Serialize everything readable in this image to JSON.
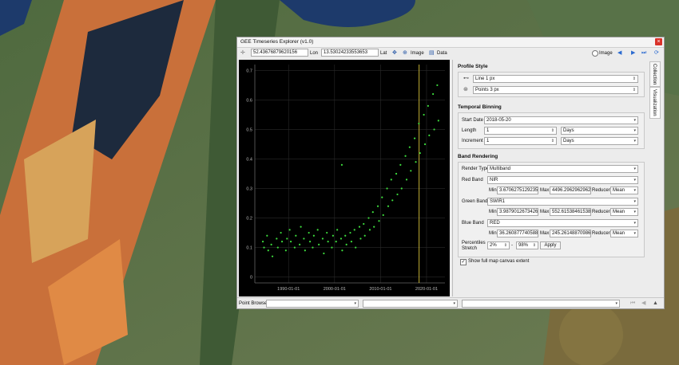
{
  "window": {
    "title": "GEE Timeseries Explorer (v1.0)",
    "close_label": "×"
  },
  "toolbar": {
    "coord1": "52.4367687962015​6",
    "coord1_label": "Lon",
    "coord2": "13.53024233553653",
    "coord2_label": "Lat",
    "image_label": "Image",
    "data_label": "Data",
    "mode_label": "Image"
  },
  "plot": {
    "y_ticks": [
      "0",
      "0.1",
      "0.2",
      "0.3",
      "0.4",
      "0.5",
      "0.6",
      "0.7"
    ],
    "x_ticks": [
      "1990-01-01",
      "2000-01-01",
      "2010-01-01",
      "2020-01-01"
    ]
  },
  "profile_style": {
    "title": "Profile Style",
    "line": "Line 1 px",
    "points": "Points 3 px"
  },
  "temporal_binning": {
    "title": "Temporal Binning",
    "start_date_label": "Start Date",
    "start_date": "2018-05-20",
    "length_label": "Length",
    "length": "1",
    "length_unit": "Days",
    "increment_label": "Increment",
    "increment": "1",
    "increment_unit": "Days"
  },
  "band_rendering": {
    "title": "Band Rendering",
    "render_type_label": "Render Type",
    "render_type": "Multiband",
    "red_label": "Red Band",
    "red_band": "NIR",
    "red_min": "3.670627512923595",
    "red_max": "4496.296296296296",
    "red_reducer": "Mean",
    "green_label": "Green Band",
    "green_band": "SWIR1",
    "green_min": "3.987901267342615",
    "green_max": "552.6153846153848",
    "green_reducer": "Mean",
    "blue_label": "Blue Band",
    "blue_band": "RED",
    "blue_min": "36.26087774058891",
    "blue_max": "245.2614887098605",
    "blue_reducer": "Mean",
    "min_label": "Min",
    "max_label": "Max",
    "reducer_label": "Reducer",
    "percentiles_label": "Percentiles Stretch",
    "pct_low": "2%",
    "pct_dash": "-",
    "pct_high": "98%",
    "apply_label": "Apply",
    "show_extent_label": "Show full map canvas extent"
  },
  "side_tabs": {
    "collection": "Collection",
    "visualization": "Visualization"
  },
  "bottom": {
    "point_browser_label": "Point Browser"
  },
  "colors": {
    "points": "#3ddc3d",
    "marker": "#d8c23a",
    "plot_bg": "#000000"
  },
  "chart_data": {
    "type": "scatter",
    "xlabel": "",
    "ylabel": "",
    "ylim": [
      -0.02,
      0.72
    ],
    "xlim": [
      "1982-09-01",
      "2024-01-01"
    ],
    "x_ticks": [
      "1990-01-01",
      "2000-01-01",
      "2010-01-01",
      "2020-01-01"
    ],
    "y_ticks": [
      0,
      0.1,
      0.2,
      0.3,
      0.4,
      0.5,
      0.6,
      0.7
    ],
    "grid": true,
    "marker_date": "2018-05-20",
    "series": [
      {
        "points": [
          [
            "1984-06-01",
            0.12
          ],
          [
            "1984-09-01",
            0.1
          ],
          [
            "1985-05-01",
            0.14
          ],
          [
            "1985-08-01",
            0.09
          ],
          [
            "1986-04-01",
            0.11
          ],
          [
            "1986-07-01",
            0.07
          ],
          [
            "1987-06-01",
            0.13
          ],
          [
            "1987-09-01",
            0.1
          ],
          [
            "1988-05-01",
            0.15
          ],
          [
            "1988-08-01",
            0.12
          ],
          [
            "1989-06-01",
            0.09
          ],
          [
            "1989-09-01",
            0.13
          ],
          [
            "1990-04-01",
            0.16
          ],
          [
            "1990-07-01",
            0.12
          ],
          [
            "1991-05-01",
            0.1
          ],
          [
            "1991-08-01",
            0.14
          ],
          [
            "1992-06-01",
            0.11
          ],
          [
            "1992-09-01",
            0.17
          ],
          [
            "1993-05-01",
            0.13
          ],
          [
            "1993-08-01",
            0.09
          ],
          [
            "1994-06-01",
            0.15
          ],
          [
            "1994-09-01",
            0.12
          ],
          [
            "1995-04-01",
            0.1
          ],
          [
            "1995-07-01",
            0.14
          ],
          [
            "1996-05-01",
            0.16
          ],
          [
            "1996-08-01",
            0.11
          ],
          [
            "1997-06-01",
            0.13
          ],
          [
            "1997-09-01",
            0.08
          ],
          [
            "1998-05-01",
            0.15
          ],
          [
            "1998-08-01",
            0.12
          ],
          [
            "1999-06-01",
            0.1
          ],
          [
            "1999-09-01",
            0.14
          ],
          [
            "2000-05-01",
            0.12
          ],
          [
            "2000-08-01",
            0.16
          ],
          [
            "2001-06-01",
            0.13
          ],
          [
            "2001-09-01",
            0.09
          ],
          [
            "2001-08-01",
            0.38
          ],
          [
            "2002-05-01",
            0.14
          ],
          [
            "2002-08-01",
            0.11
          ],
          [
            "2003-06-01",
            0.15
          ],
          [
            "2003-09-01",
            0.12
          ],
          [
            "2004-05-01",
            0.16
          ],
          [
            "2004-08-01",
            0.1
          ],
          [
            "2005-06-01",
            0.17
          ],
          [
            "2005-09-01",
            0.13
          ],
          [
            "2006-05-01",
            0.18
          ],
          [
            "2006-08-01",
            0.14
          ],
          [
            "2007-06-01",
            0.2
          ],
          [
            "2007-09-01",
            0.16
          ],
          [
            "2008-05-01",
            0.22
          ],
          [
            "2008-08-01",
            0.17
          ],
          [
            "2009-06-01",
            0.24
          ],
          [
            "2009-09-01",
            0.19
          ],
          [
            "2010-05-01",
            0.27
          ],
          [
            "2010-08-01",
            0.21
          ],
          [
            "2011-06-01",
            0.3
          ],
          [
            "2011-09-01",
            0.24
          ],
          [
            "2012-05-01",
            0.33
          ],
          [
            "2012-08-01",
            0.26
          ],
          [
            "2013-06-01",
            0.35
          ],
          [
            "2013-09-01",
            0.28
          ],
          [
            "2014-05-01",
            0.38
          ],
          [
            "2014-08-01",
            0.3
          ],
          [
            "2015-06-01",
            0.41
          ],
          [
            "2015-09-01",
            0.33
          ],
          [
            "2016-05-01",
            0.44
          ],
          [
            "2016-08-01",
            0.36
          ],
          [
            "2017-06-01",
            0.47
          ],
          [
            "2017-09-01",
            0.39
          ],
          [
            "2018-05-01",
            0.52
          ],
          [
            "2018-08-01",
            0.42
          ],
          [
            "2019-06-01",
            0.55
          ],
          [
            "2019-09-01",
            0.45
          ],
          [
            "2020-05-01",
            0.58
          ],
          [
            "2020-08-01",
            0.48
          ],
          [
            "2021-06-01",
            0.62
          ],
          [
            "2021-09-01",
            0.5
          ],
          [
            "2022-05-01",
            0.65
          ],
          [
            "2022-08-01",
            0.53
          ]
        ]
      }
    ]
  }
}
